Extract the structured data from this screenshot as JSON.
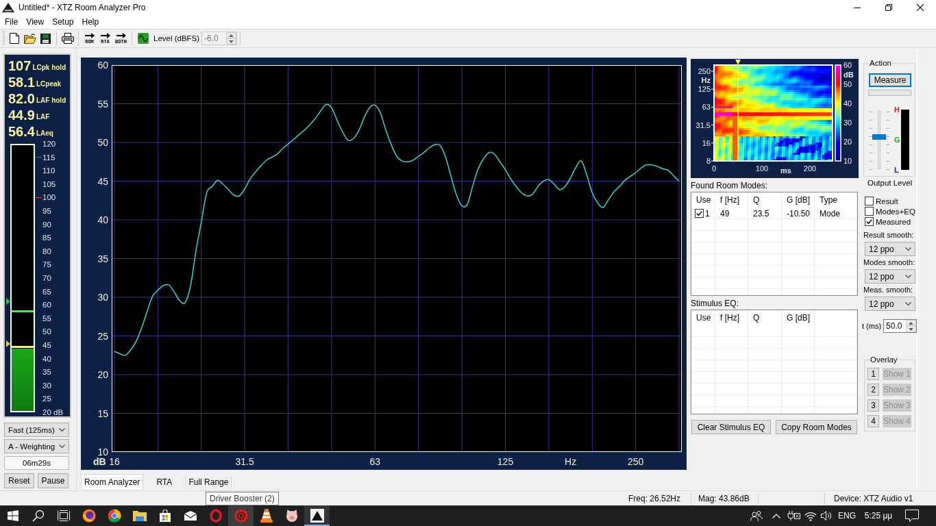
{
  "window": {
    "title": "Untitled* - XTZ Room Analyzer Pro"
  },
  "menu": [
    "File",
    "View",
    "Setup",
    "Help"
  ],
  "toolbar": {
    "mode_buttons": [
      "ROM",
      "RTA",
      "BOTH"
    ],
    "level": {
      "label": "Level (dBFS)",
      "value": "-6.0",
      "disabled": true
    }
  },
  "meter": {
    "readouts": [
      {
        "reading": "107",
        "quantity": "LCpk hold"
      },
      {
        "reading": "58.1",
        "quantity": "LCpeak"
      },
      {
        "reading": "82.0",
        "quantity": "LAF hold"
      },
      {
        "reading": "44.9",
        "quantity": "LAF"
      },
      {
        "reading": "56.4",
        "quantity": "LAeq"
      }
    ],
    "level": 0.235,
    "markers": [
      {
        "kind": "line",
        "level": 0.374,
        "color": "#33ff33"
      },
      {
        "kind": "line",
        "level": 0.24,
        "color": "#ffff33"
      },
      {
        "kind": "pointer",
        "level": 0.412,
        "color": "#22cc22"
      },
      {
        "kind": "pointer",
        "level": 0.253,
        "color": "#e6d21e"
      }
    ],
    "scale": [
      {
        "label": "120",
        "tick": false
      },
      {
        "label": "115",
        "tick": true
      },
      {
        "label": "110",
        "tick": false
      },
      {
        "label": "105",
        "tick": false
      },
      {
        "label": "100",
        "tick": true
      },
      {
        "label": "95",
        "tick": false
      },
      {
        "label": "90",
        "tick": false
      },
      {
        "label": "85",
        "tick": false
      },
      {
        "label": "80",
        "tick": false
      },
      {
        "label": "75",
        "tick": false
      },
      {
        "label": "70",
        "tick": false
      },
      {
        "label": "65",
        "tick": false
      },
      {
        "label": "60",
        "tick": false
      },
      {
        "label": "55",
        "tick": false
      },
      {
        "label": "50",
        "tick": false
      },
      {
        "label": "45",
        "tick": false
      },
      {
        "label": "40",
        "tick": false
      },
      {
        "label": "35",
        "tick": false
      },
      {
        "label": "30",
        "tick": false
      },
      {
        "label": "25",
        "tick": false
      },
      {
        "label": "20 dB",
        "tick": false
      }
    ]
  },
  "meter_controls": {
    "response": "Fast (125ms)",
    "weighting": "A - Weighting",
    "elapsed": "06m29s",
    "buttons": [
      "Reset",
      "Pause"
    ]
  },
  "chart": {
    "chart_data": {
      "type": "line",
      "xlabel": "Hz",
      "ylabel": "dB",
      "grid": true,
      "categories": [
        "16",
        null,
        null,
        null,
        null,
        null,
        null,
        null,
        null,
        null,
        null,
        null,
        null,
        null,
        null,
        null,
        null,
        null,
        null,
        null,
        null,
        null,
        null,
        null,
        "31.5",
        null,
        null,
        null,
        null,
        null,
        null,
        null,
        null,
        null,
        null,
        null,
        null,
        null,
        null,
        null,
        null,
        null,
        null,
        null,
        null,
        null,
        null,
        null,
        "63",
        null,
        null,
        null,
        null,
        null,
        null,
        null,
        null,
        null,
        null,
        null,
        null,
        null,
        null,
        null,
        null,
        null,
        null,
        null,
        null,
        null,
        null,
        null,
        "125",
        null,
        null,
        null,
        null,
        null,
        null,
        null,
        null,
        null,
        null,
        null,
        null,
        null,
        null,
        null,
        null,
        null,
        null,
        null,
        null,
        null,
        null,
        null,
        "250",
        null,
        null,
        null,
        null,
        null,
        null,
        null,
        null
      ],
      "series": [
        {
          "color": "#3ec8c8",
          "values": [
            23.0,
            22.7,
            22.5,
            23.2,
            24.3,
            26.0,
            28.1,
            30.1,
            30.9,
            31.5,
            31.6,
            30.7,
            29.6,
            29.3,
            31.4,
            35.9,
            39.7,
            43.5,
            44.3,
            45.1,
            44.6,
            43.9,
            43.2,
            43.1,
            44.0,
            45.3,
            46.2,
            47.0,
            47.7,
            48.1,
            48.5,
            49.2,
            49.8,
            50.4,
            51.0,
            51.6,
            52.3,
            53.1,
            54.1,
            54.9,
            54.5,
            52.9,
            51.4,
            50.3,
            50.5,
            51.5,
            53.2,
            54.5,
            54.8,
            53.8,
            51.6,
            49.7,
            48.2,
            47.6,
            47.5,
            47.7,
            48.2,
            48.7,
            49.3,
            49.7,
            49.6,
            48.1,
            45.6,
            43.2,
            41.8,
            42.0,
            44.4,
            46.6,
            47.9,
            48.7,
            48.5,
            47.5,
            46.5,
            45.3,
            44.3,
            43.5,
            43.1,
            43.3,
            44.3,
            45.0,
            45.2,
            44.6,
            43.9,
            44.3,
            45.4,
            46.8,
            47.6,
            45.8,
            43.5,
            42.2,
            41.6,
            42.6,
            43.6,
            44.3,
            45.1,
            45.6,
            46.1,
            46.7,
            47.1,
            47.1,
            46.9,
            46.6,
            46.4,
            45.7,
            45.0
          ]
        }
      ],
      "ylim": [
        10,
        60
      ],
      "yticks": [
        10,
        15,
        20,
        25,
        30,
        35,
        40,
        45,
        50,
        55,
        60
      ]
    }
  },
  "tabs": [
    {
      "label": "Room Analyzer",
      "selected": true
    },
    {
      "label": "RTA",
      "selected": false
    },
    {
      "label": "Full Range",
      "selected": false
    }
  ],
  "spectrogram": {
    "freq_ticks": [
      {
        "label": "250",
        "kind": "value"
      },
      {
        "label": "Hz",
        "kind": "unit"
      },
      {
        "label": "125",
        "kind": "value"
      },
      {
        "label": "63",
        "kind": "value"
      },
      {
        "label": "31.5",
        "kind": "value"
      },
      {
        "label": "16",
        "kind": "value"
      },
      {
        "label": "8",
        "kind": "value"
      }
    ],
    "time_ticks": [
      {
        "label": "0",
        "kind": "value"
      },
      {
        "label": "100",
        "kind": "value"
      },
      {
        "label": "ms",
        "kind": "unit"
      },
      {
        "label": "200",
        "kind": "value"
      }
    ],
    "scale_ticks": [
      {
        "label": "60",
        "kind": "value"
      },
      {
        "label": "dB",
        "kind": "unit"
      },
      {
        "label": "50",
        "kind": "value"
      },
      {
        "label": "40",
        "kind": "value"
      },
      {
        "label": "30",
        "kind": "value"
      },
      {
        "label": "20",
        "kind": "value"
      },
      {
        "label": "10",
        "kind": "value"
      }
    ]
  },
  "room_modes": {
    "title": "Found Room Modes:",
    "columns": [
      "Use",
      "f [Hz]",
      "Q",
      "G [dB]",
      "Type"
    ],
    "rows": [
      {
        "checked": true,
        "cells": [
          "1",
          "49",
          "23.5",
          "-10.50",
          "Mode"
        ]
      }
    ]
  },
  "stimulus_eq": {
    "title": "Stimulus EQ:",
    "columns": [
      "Use",
      "f [Hz]",
      "Q",
      "G [dB]"
    ]
  },
  "table_buttons": [
    "Clear Stimulus EQ",
    "Copy Room Modes"
  ],
  "action": {
    "title": "Action",
    "measure": {
      "label": "Measure",
      "focused": true
    },
    "progress": {
      "active": false
    },
    "slider": {
      "level": 0.55
    },
    "scale_marks": [
      {
        "label": "H",
        "color": "#d42020"
      },
      {
        "label": "G",
        "color": "#22a822"
      },
      {
        "label": "L",
        "color": "#1a1ac8"
      }
    ],
    "caption": "Output Level"
  },
  "display": {
    "checkboxes": [
      {
        "label": "Result",
        "checked": false
      },
      {
        "label": "Modes+EQ",
        "checked": false
      },
      {
        "label": "Measured",
        "checked": true
      }
    ],
    "smoothing": [
      {
        "label": "Result smooth:",
        "value": "12 ppo"
      },
      {
        "label": "Modes smooth:",
        "value": "12 ppo"
      },
      {
        "label": "Meas. smooth:",
        "value": "12 ppo"
      }
    ],
    "time": {
      "label": "t (ms)",
      "value": "50.0"
    }
  },
  "overlay": {
    "title": "Overlay",
    "items": [
      {
        "number": "1",
        "label": "Show 1",
        "disabled": true
      },
      {
        "number": "2",
        "label": "Show 2",
        "disabled": true
      },
      {
        "number": "3",
        "label": "Show 3",
        "disabled": true
      },
      {
        "number": "4",
        "label": "Show 4",
        "disabled": true
      }
    ]
  },
  "tooltip": {
    "text": "Driver Booster (2)"
  },
  "status_bar": {
    "freq": "Freq: 26.52Hz",
    "mag": "Mag: 43.86dB",
    "device": "Device: XTZ Audio v1"
  },
  "taskbar": {
    "apps": [
      {
        "selected": false,
        "hovered": false
      },
      {
        "selected": false,
        "hovered": false
      },
      {
        "selected": false,
        "hovered": false
      },
      {
        "selected": false,
        "hovered": false
      },
      {
        "selected": false,
        "hovered": false
      },
      {
        "selected": false,
        "hovered": false
      },
      {
        "selected": false,
        "hovered": false
      },
      {
        "selected": false,
        "hovered": false
      },
      {
        "selected": false,
        "hovered": false
      },
      {
        "selected": false,
        "hovered": true
      },
      {
        "selected": false,
        "hovered": false
      },
      {
        "selected": false,
        "hovered": false
      },
      {
        "selected": true,
        "hovered": false
      }
    ]
  },
  "tray": {
    "language": "ENG",
    "time": "5:25 μμ"
  }
}
